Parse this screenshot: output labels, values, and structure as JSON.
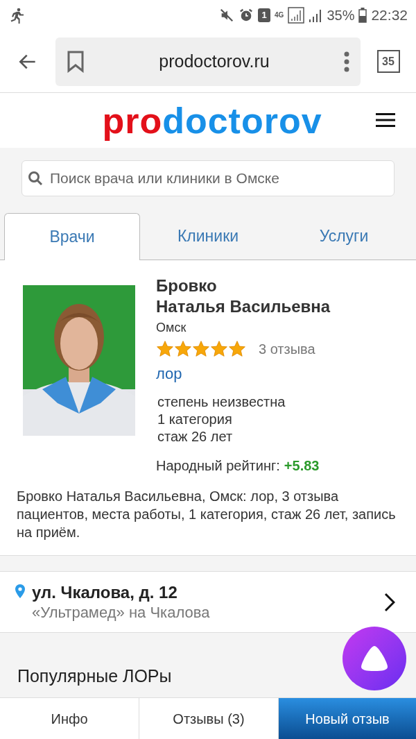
{
  "status_bar": {
    "sim": "1",
    "network": "4G",
    "battery": "35%",
    "time": "22:32"
  },
  "browser": {
    "url": "prodoctorov.ru",
    "tab_count": "35"
  },
  "logo": {
    "part_1": "pro",
    "part_2": "doctorov"
  },
  "search": {
    "placeholder": "Поиск врача или клиники в Омске"
  },
  "tabs": [
    {
      "label": "Врачи",
      "selected": true
    },
    {
      "label": "Клиники",
      "selected": false
    },
    {
      "label": "Услуги",
      "selected": false
    }
  ],
  "doctor": {
    "surname": "Бровко",
    "name": "Наталья Васильевна",
    "city": "Омск",
    "stars": 5,
    "reviews": "3 отзыва",
    "specialty": "лор",
    "details": [
      "степень неизвестна",
      "1 категория",
      "стаж 26 лет"
    ],
    "rating_label": "Народный рейтинг:",
    "rating_value": "+5.83",
    "description": "Бровко Наталья Васильевна, Омск: лор, 3 отзыва пациентов, места работы, 1 категория, стаж 26 лет, запись на приём."
  },
  "address": {
    "street": "ул. Чкалова, д. 12",
    "clinic": "«Ультрамед» на Чкалова"
  },
  "section_title": "Популярные ЛОРы",
  "bottom_bar": [
    {
      "label": "Инфо",
      "kind": "plain"
    },
    {
      "label": "Отзывы (3)",
      "kind": "plain"
    },
    {
      "label": "Новый отзыв",
      "kind": "primary"
    }
  ]
}
